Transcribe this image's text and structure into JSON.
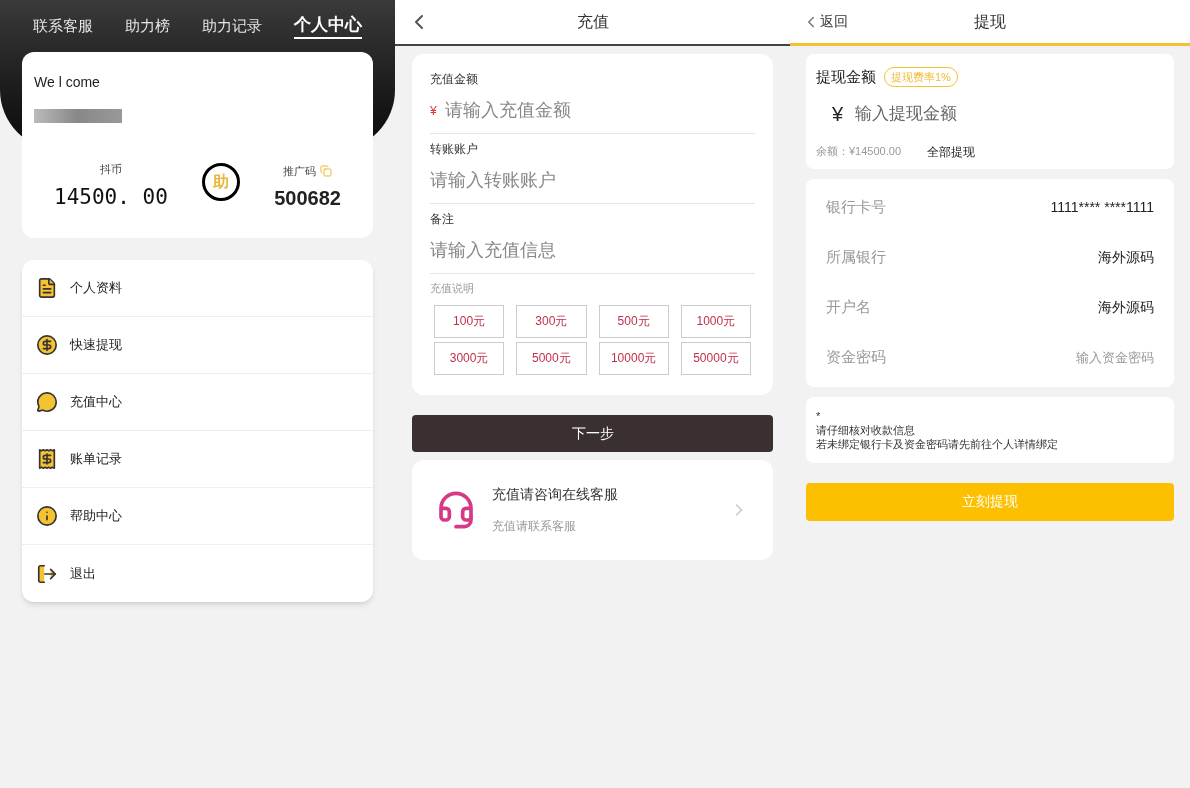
{
  "profile_screen": {
    "tabs": [
      {
        "label": "联系客服",
        "selected": false
      },
      {
        "label": "助力榜",
        "selected": false
      },
      {
        "label": "助力记录",
        "selected": false
      },
      {
        "label": "个人中心",
        "selected": true
      }
    ],
    "welcome": "We l come",
    "coin_label": "抖币",
    "coin_value": "14500. 00",
    "badge": "助",
    "promo_label": "推广码",
    "promo_value": "500682",
    "menu": [
      {
        "label": "个人资料",
        "kind": "profile"
      },
      {
        "label": "快速提现",
        "kind": "withdraw"
      },
      {
        "label": "充值中心",
        "kind": "recharge"
      },
      {
        "label": "账单记录",
        "kind": "bill"
      },
      {
        "label": "帮助中心",
        "kind": "help"
      },
      {
        "label": "退出",
        "kind": "logout"
      }
    ]
  },
  "recharge_screen": {
    "title": "充值",
    "fields": [
      {
        "label": "充值金额",
        "prefix": "¥",
        "placeholder": "请输入充值金额"
      },
      {
        "label": "转账账户",
        "placeholder": "请输入转账账户"
      },
      {
        "label": "备注",
        "placeholder": "请输入充值信息"
      }
    ],
    "note_label": "充值说明",
    "amounts": [
      "100元",
      "300元",
      "500元",
      "1000元",
      "3000元",
      "5000元",
      "10000元",
      "50000元"
    ],
    "next_button": "下一步",
    "service_title": "充值请咨询在线客服",
    "service_subtitle": "充值请联系客服"
  },
  "withdraw_screen": {
    "back": "返回",
    "title": "提现",
    "amount_label": "提现金额",
    "fee_tag": "提现费率1%",
    "currency": "¥",
    "amount_placeholder": "输入提现金额",
    "balance": "余额：¥14500.00",
    "withdraw_all": "全部提现",
    "rows": [
      {
        "label": "银行卡号",
        "value": "1111**** ****1111",
        "kind": "text"
      },
      {
        "label": "所属银行",
        "value": "海外源码",
        "kind": "text"
      },
      {
        "label": "开户名",
        "value": "海外源码",
        "kind": "text"
      },
      {
        "label": "资金密码",
        "placeholder": "输入资金密码",
        "kind": "input"
      }
    ],
    "notes": [
      "*",
      "请仔细核对收款信息",
      "若未绑定银行卡及资金密码请先前往个人详情绑定"
    ],
    "submit_button": "立刻提现"
  }
}
